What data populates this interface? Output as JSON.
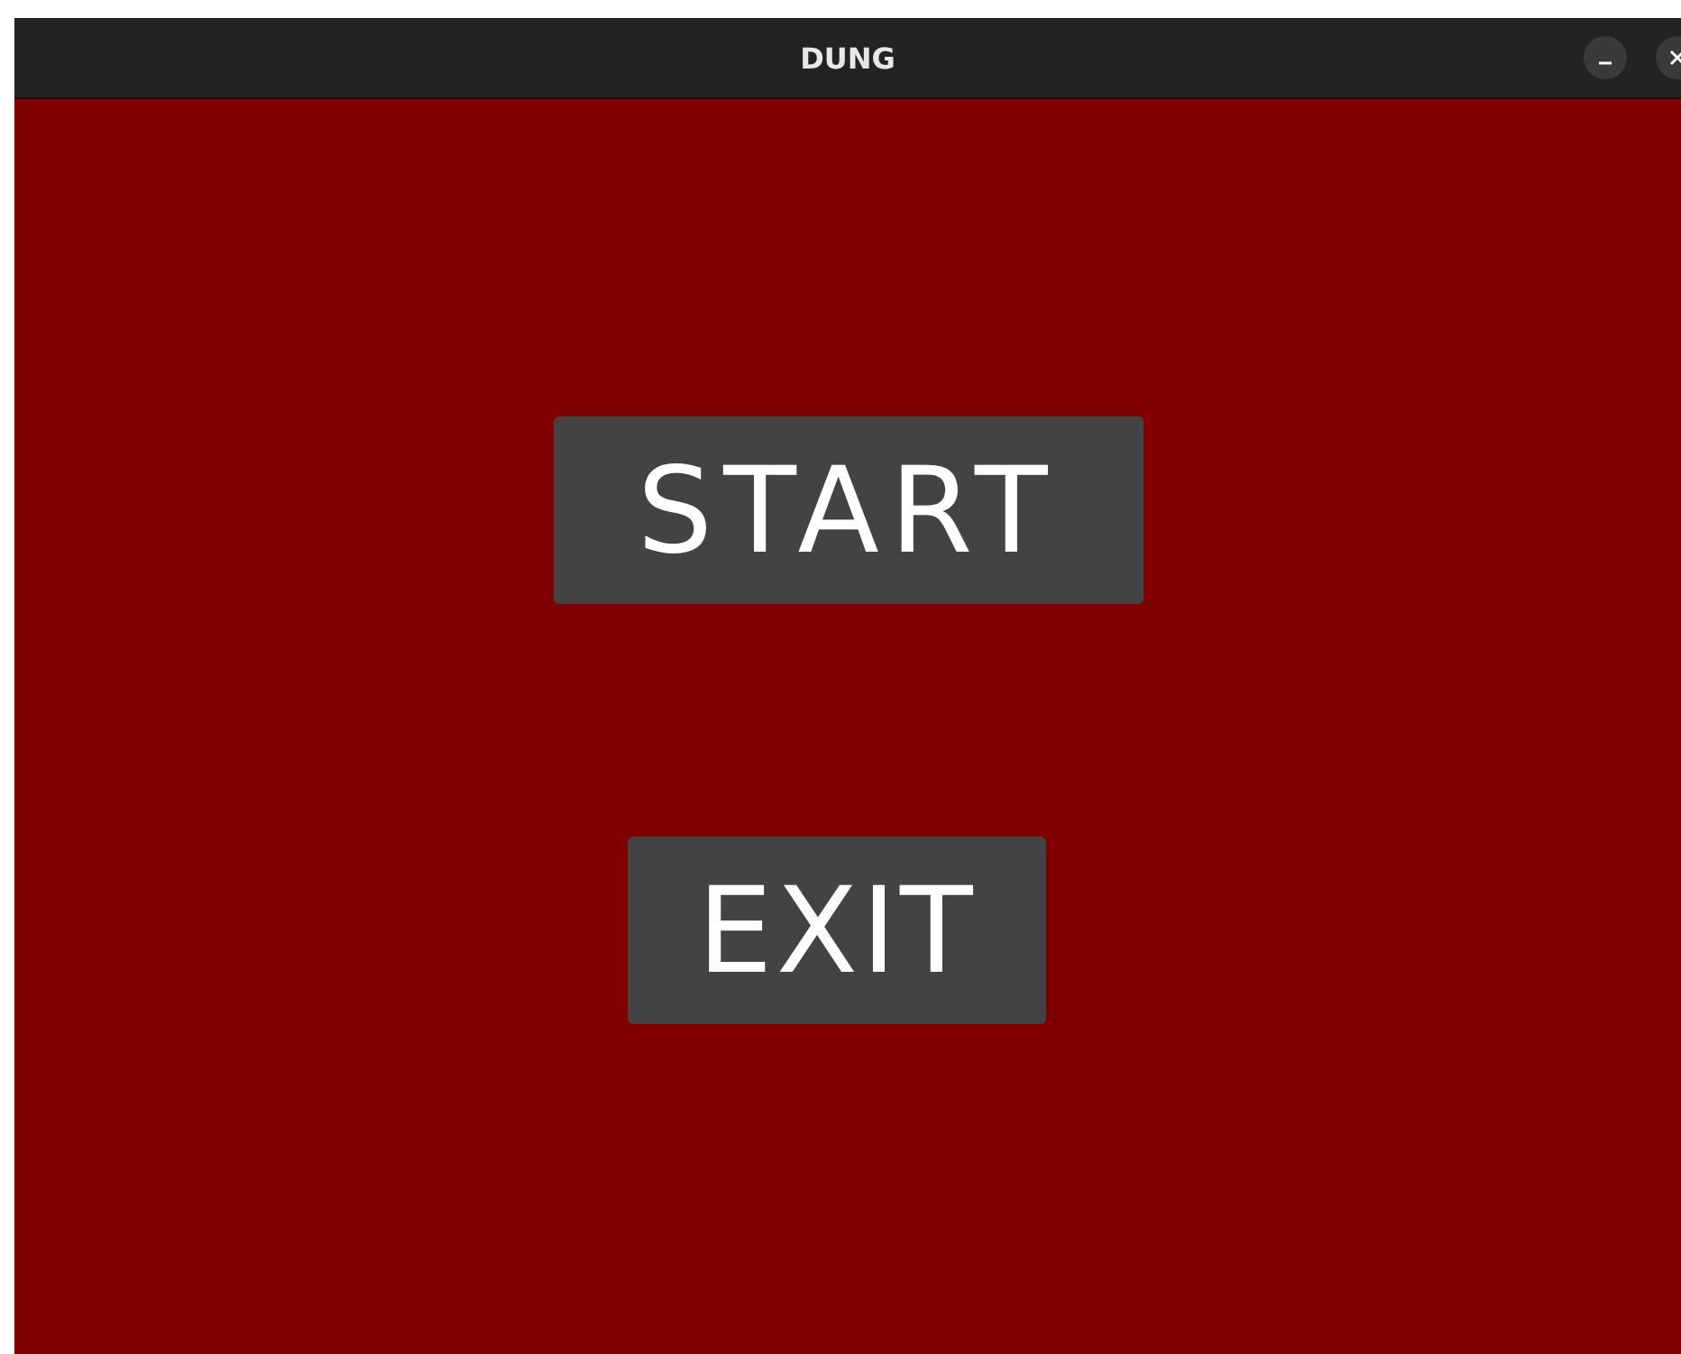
{
  "window": {
    "title": "DUNG"
  },
  "menu": {
    "buttons": [
      {
        "label": "START"
      },
      {
        "label": "EXIT"
      }
    ]
  }
}
